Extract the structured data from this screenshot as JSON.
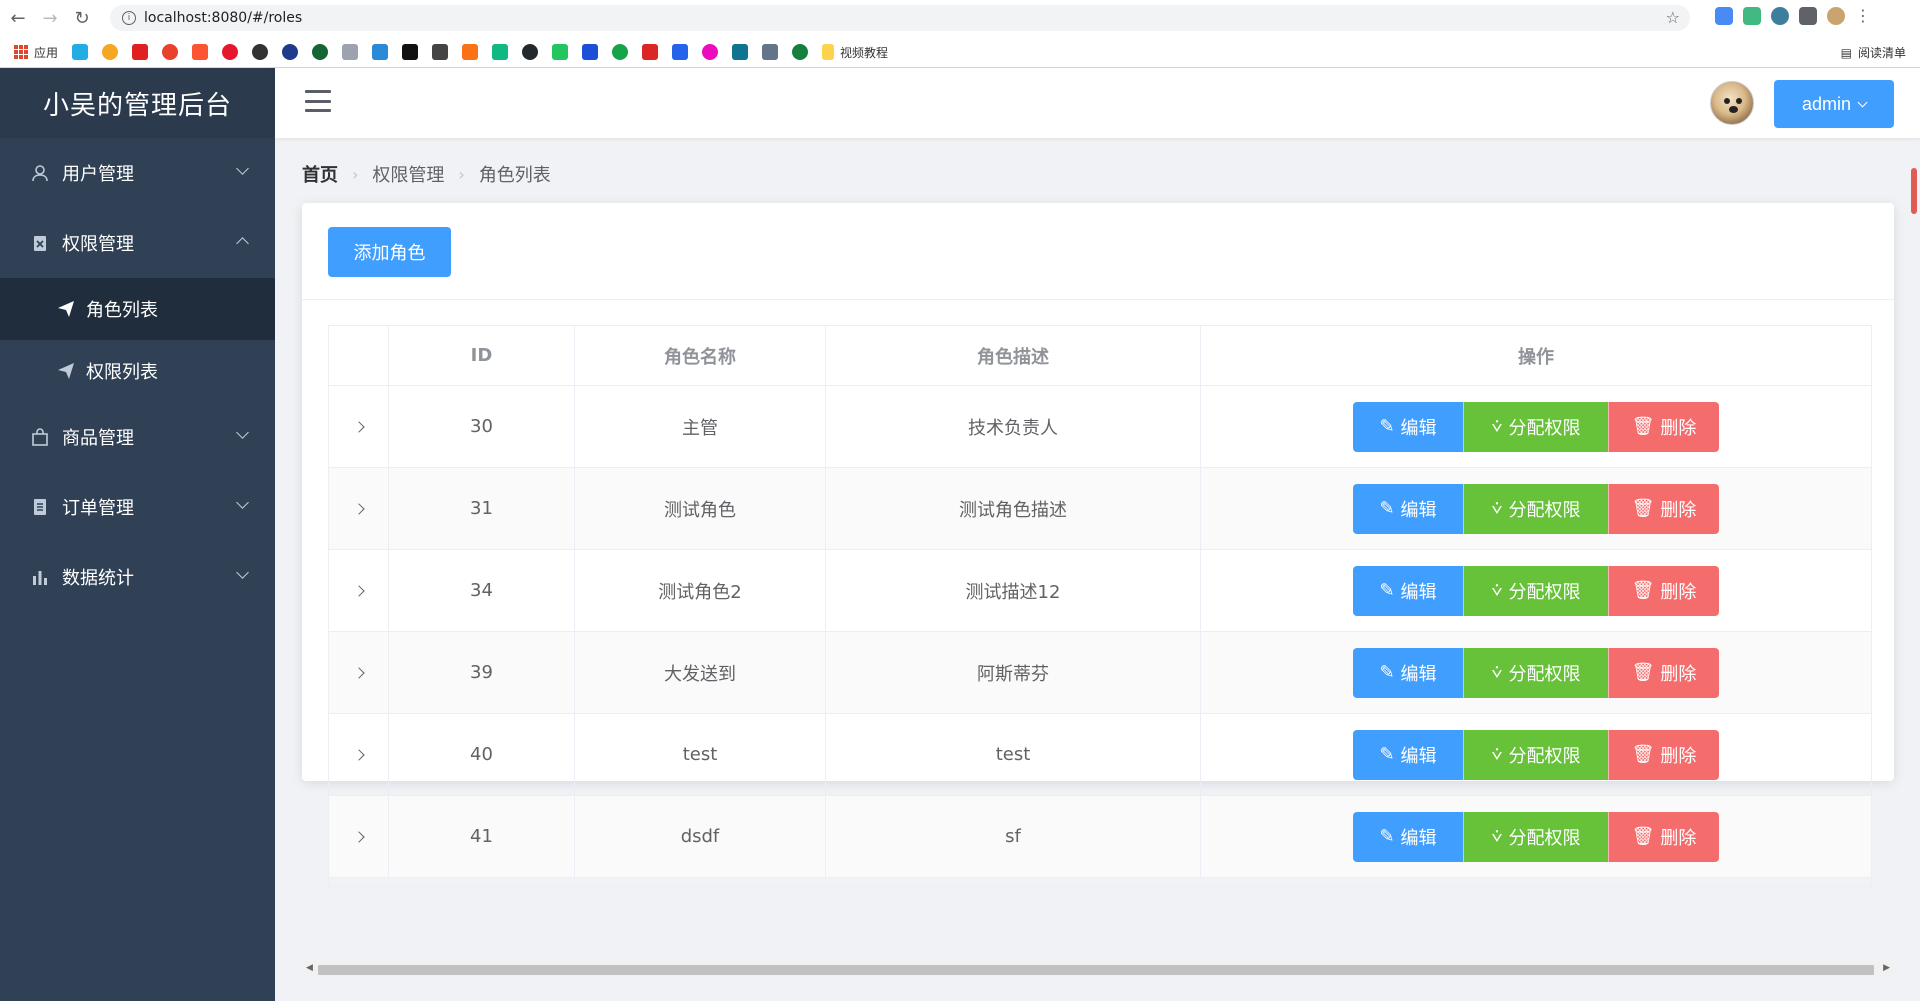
{
  "browser": {
    "url": "localhost:8080/#/roles",
    "bookmarks_apps_label": "应用",
    "bookmark_video": "视频教程",
    "reading_list": "阅读清单"
  },
  "sidebar": {
    "logo": "小吴的管理后台",
    "items": [
      {
        "label": "用户管理",
        "icon": "user-icon",
        "expanded": false
      },
      {
        "label": "权限管理",
        "icon": "clipboard-icon",
        "expanded": true
      },
      {
        "label": "商品管理",
        "icon": "shopping-bag-icon",
        "expanded": false
      },
      {
        "label": "订单管理",
        "icon": "document-icon",
        "expanded": false
      },
      {
        "label": "数据统计",
        "icon": "bar-chart-icon",
        "expanded": false
      }
    ],
    "sub_items": [
      {
        "label": "角色列表",
        "icon": "paper-plane-icon",
        "active": true
      },
      {
        "label": "权限列表",
        "icon": "paper-plane-icon",
        "active": false
      }
    ]
  },
  "header": {
    "user_label": "admin"
  },
  "breadcrumb": [
    "首页",
    "权限管理",
    "角色列表"
  ],
  "main": {
    "add_button": "添加角色",
    "columns": [
      "",
      "ID",
      "角色名称",
      "角色描述",
      "操作"
    ],
    "rows": [
      {
        "id": "30",
        "name": "主管",
        "desc": "技术负责人"
      },
      {
        "id": "31",
        "name": "测试角色",
        "desc": "测试角色描述"
      },
      {
        "id": "34",
        "name": "测试角色2",
        "desc": "测试描述12"
      },
      {
        "id": "39",
        "name": "大发送到",
        "desc": "阿斯蒂芬"
      },
      {
        "id": "40",
        "name": "test",
        "desc": "test"
      },
      {
        "id": "41",
        "name": "dsdf",
        "desc": "sf"
      }
    ],
    "actions": {
      "edit": "编辑",
      "assign": "分配权限",
      "delete": "删除"
    }
  },
  "colors": {
    "primary": "#409eff",
    "success": "#67c23a",
    "danger": "#f56c6c",
    "sidebar_bg": "#304156"
  }
}
